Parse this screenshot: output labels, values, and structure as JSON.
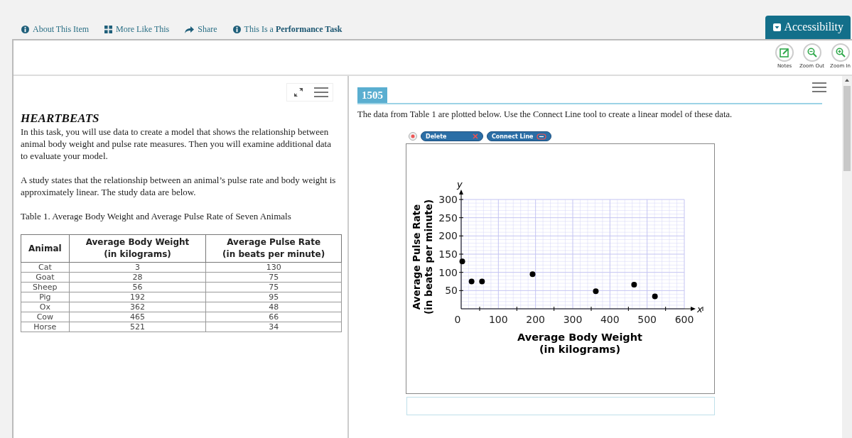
{
  "top_links": [
    {
      "kind": "info",
      "label": "About This Item"
    },
    {
      "kind": "grid",
      "label": "More Like This"
    },
    {
      "kind": "share",
      "label": "Share"
    },
    {
      "kind": "info",
      "label": "This Is a **Performance Task**"
    }
  ],
  "accessibility_button": "Accessibility",
  "tools": [
    {
      "kind": "notes",
      "label": "Notes"
    },
    {
      "kind": "zoom_out",
      "label": "Zoom Out"
    },
    {
      "kind": "zoom_in",
      "label": "Zoom In"
    }
  ],
  "passage": {
    "title": "HEARTBEATS",
    "paragraphs": [
      "In this task, you will use data to create a model that shows the relationship between animal body weight and pulse rate measures. Then you will examine additional data to evaluate your model.",
      "A study states that the relationship between an animal’s pulse rate and body weight is approximately linear. The study data are below.",
      "Table 1. Average Body Weight and Average Pulse Rate of Seven Animals"
    ],
    "table": {
      "columns": [
        "Animal",
        "Average Body Weight (in kilograms)",
        "Average Pulse Rate (in beats per minute)"
      ],
      "rows": [
        [
          "Cat",
          "3",
          "130"
        ],
        [
          "Goat",
          "28",
          "75"
        ],
        [
          "Sheep",
          "56",
          "75"
        ],
        [
          "Pig",
          "192",
          "95"
        ],
        [
          "Ox",
          "362",
          "48"
        ],
        [
          "Cow",
          "465",
          "66"
        ],
        [
          "Horse",
          "521",
          "34"
        ]
      ]
    }
  },
  "item": {
    "number": "1505",
    "prompt": "The data from Table 1 are plotted below. Use the Connect Line tool to create a linear model of these data.",
    "chart_tools": [
      {
        "kind": "delete",
        "label": "Delete"
      },
      {
        "kind": "connect_line",
        "label": "Connect Line"
      }
    ],
    "chart_data": {
      "type": "scatter",
      "xlabel": "Average Body Weight (in kilograms)",
      "ylabel": "Average Pulse Rate (in beats per minute)",
      "grid": true,
      "annotations": [
        "x",
        "y"
      ],
      "x": [
        3,
        28,
        56,
        192,
        362,
        465,
        521
      ],
      "series": [
        {
          "color": "#000000",
          "values": [
            130,
            75,
            75,
            95,
            48,
            66,
            34
          ]
        }
      ],
      "xlim": [
        0,
        600
      ],
      "ylim": [
        0,
        300
      ],
      "xticks": [
        0,
        100,
        200,
        300,
        400,
        500,
        600
      ],
      "yticks": [
        50,
        100,
        150,
        200,
        250,
        300
      ]
    }
  }
}
